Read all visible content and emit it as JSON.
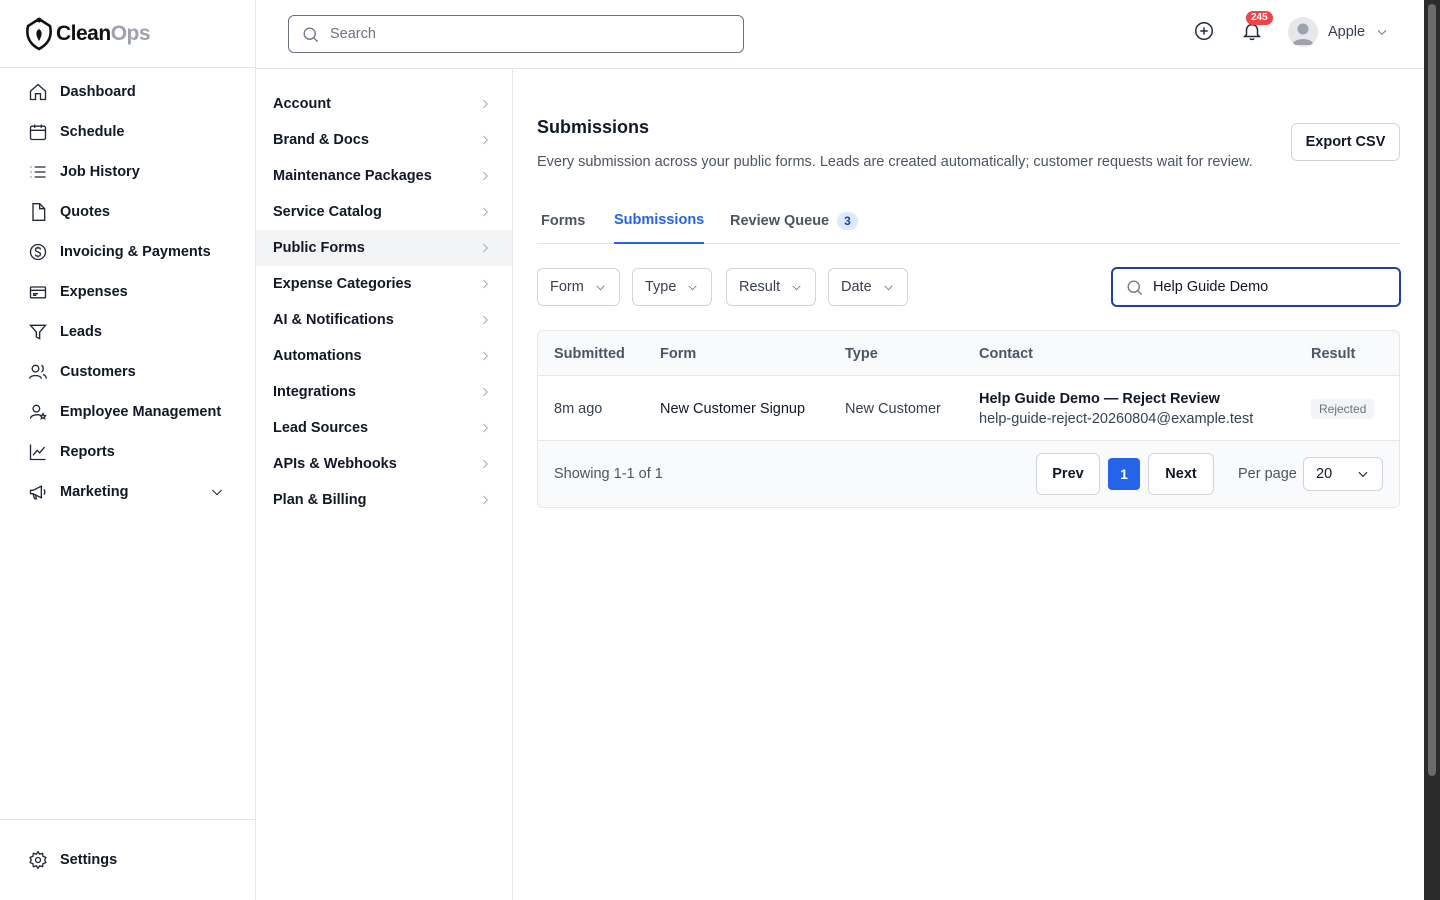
{
  "brand": {
    "name_primary": "Clean",
    "name_secondary": "Ops"
  },
  "sidebar": {
    "items": [
      {
        "label": "Dashboard",
        "icon": "home-icon"
      },
      {
        "label": "Schedule",
        "icon": "calendar-icon"
      },
      {
        "label": "Job History",
        "icon": "list-icon"
      },
      {
        "label": "Quotes",
        "icon": "document-icon"
      },
      {
        "label": "Invoicing & Payments",
        "icon": "dollar-icon"
      },
      {
        "label": "Expenses",
        "icon": "receipt-icon"
      },
      {
        "label": "Leads",
        "icon": "filter-icon"
      },
      {
        "label": "Customers",
        "icon": "users-icon"
      },
      {
        "label": "Employee Management",
        "icon": "user-gear-icon"
      },
      {
        "label": "Reports",
        "icon": "chart-icon"
      },
      {
        "label": "Marketing",
        "icon": "megaphone-icon"
      }
    ],
    "settings_label": "Settings"
  },
  "topbar": {
    "search_placeholder": "Search",
    "notification_count": "245",
    "user_name": "Apple"
  },
  "subnav": {
    "items": [
      "Account",
      "Brand & Docs",
      "Maintenance Packages",
      "Service Catalog",
      "Public Forms",
      "Expense Categories",
      "AI & Notifications",
      "Automations",
      "Integrations",
      "Lead Sources",
      "APIs & Webhooks",
      "Plan & Billing"
    ],
    "active": "Public Forms"
  },
  "main": {
    "title": "Submissions",
    "description": "Every submission across your public forms. Leads are created automatically; customer requests wait for review.",
    "export_label": "Export CSV",
    "tabs": [
      {
        "label": "Forms"
      },
      {
        "label": "Submissions",
        "active": true
      },
      {
        "label": "Review Queue",
        "count": "3"
      }
    ],
    "filters": [
      "Form",
      "Type",
      "Result",
      "Date"
    ],
    "filter_search_value": "Help Guide Demo",
    "table": {
      "headers": [
        "Submitted",
        "Form",
        "Type",
        "Contact",
        "Result"
      ],
      "rows": [
        {
          "submitted": "8m ago",
          "form": "New Customer Signup",
          "type": "New Customer",
          "contact_name": "Help Guide Demo — Reject Review",
          "contact_email": "help-guide-reject-20260804@example.test",
          "result": "Rejected"
        }
      ]
    },
    "pagination": {
      "showing": "Showing 1-1 of 1",
      "prev": "Prev",
      "current": "1",
      "next": "Next",
      "per_page_label": "Per page",
      "per_page_value": "20"
    }
  },
  "colors": {
    "accent": "#2563eb",
    "notification": "#ef4444"
  }
}
